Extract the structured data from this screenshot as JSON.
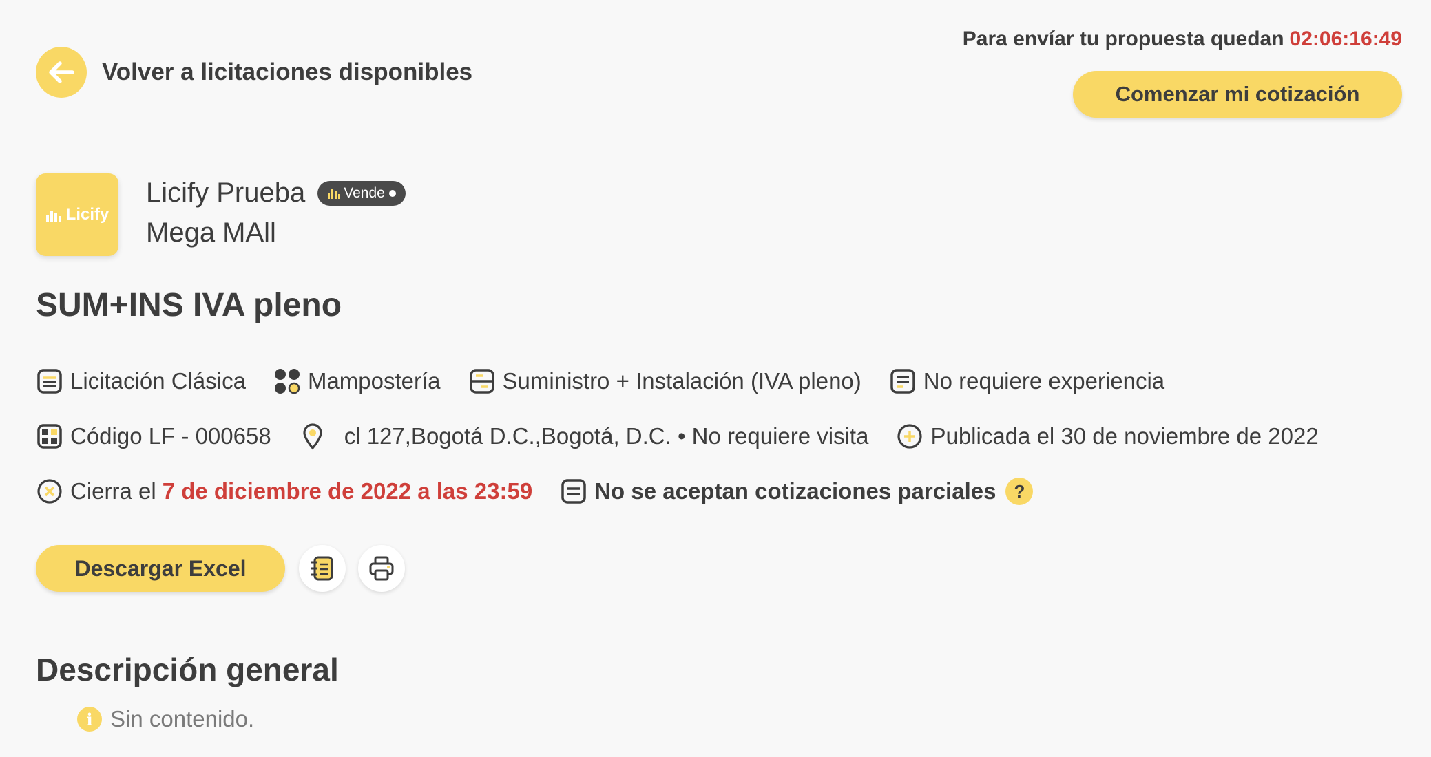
{
  "header": {
    "back_label": "Volver a licitaciones disponibles",
    "timer_label": "Para envíar tu propuesta quedan",
    "timer_value": "02:06:16:49",
    "start_button": "Comenzar mi cotización"
  },
  "company": {
    "logo_text": "Licify",
    "name": "Licify Prueba",
    "badge": "Vende",
    "project": "Mega MAll"
  },
  "tender": {
    "title": "SUM+INS IVA pleno",
    "type": "Licitación Clásica",
    "category": "Mampostería",
    "modality": "Suministro + Instalación (IVA pleno)",
    "experience": "No requiere experiencia",
    "code": "Código LF - 000658",
    "location": "cl 127,Bogotá D.C.,Bogotá, D.C. • No requiere visita",
    "published": "Publicada el 30 de noviembre de 2022",
    "closes_prefix": "Cierra el",
    "closes_date": "7 de diciembre de 2022 a las 23:59",
    "partial": "No se aceptan cotizaciones parciales",
    "help_glyph": "?"
  },
  "actions": {
    "excel_button": "Descargar Excel"
  },
  "description": {
    "title": "Descripción general",
    "empty_text": "Sin contenido.",
    "info_glyph": "i"
  },
  "colors": {
    "accent": "#f9d865",
    "danger": "#cf3f3a",
    "text": "#3d3d3d",
    "background": "#f8f8f8"
  }
}
